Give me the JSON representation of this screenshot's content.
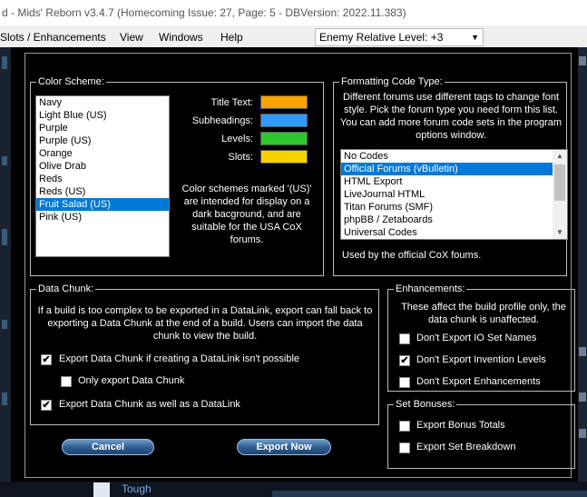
{
  "window": {
    "title": "d - Mids' Reborn v3.4.7  (Homecoming Issue: 27, Page: 5 - DBVersion: 2022.11.383)"
  },
  "menu": {
    "items": [
      "Slots / Enhancements",
      "View",
      "Windows",
      "Help"
    ],
    "enemy_level": "Enemy Relative Level: +3"
  },
  "background": {
    "power_label": "Tough"
  },
  "color_scheme": {
    "label": "Color Scheme:",
    "options": [
      "Navy",
      "Light Blue (US)",
      "Purple",
      "Purple (US)",
      "Orange",
      "Olive Drab",
      "Reds",
      "Reds (US)",
      "Fruit Salad (US)",
      "Pink (US)"
    ],
    "selected": "Fruit Salad (US)",
    "swatch_labels": {
      "title_text": "Title Text:",
      "subheadings": "Subheadings:",
      "levels": "Levels:",
      "slots": "Slots:"
    },
    "swatch_colors": {
      "title_text": "#f7a300",
      "subheadings": "#2f9bff",
      "levels": "#2ec72e",
      "slots": "#f5d200"
    },
    "note": "Color schemes marked '(US)' are intended for display on a dark bacground, and are suitable for the USA CoX forums."
  },
  "formatting": {
    "label": "Formatting Code Type:",
    "description": "Different forums use different tags to change font style. Pick the forum type you need form this list. You can add more forum code sets in the program options window.",
    "options": [
      "No Codes",
      "Official Forums (vBulletin)",
      "HTML Export",
      "LiveJournal HTML",
      "Titan Forums (SMF)",
      "phpBB / Zetaboards",
      "Universal Codes"
    ],
    "selected": "Official Forums (vBulletin)",
    "selection_info": "Used by the official CoX foums."
  },
  "data_chunk": {
    "label": "Data Chunk:",
    "description": "If a build is too complex to be exported in a DataLink, export can fall back to exporting a Data Chunk at the end of a build. Users can import the data chunk to view the build.",
    "opt_fallback": {
      "label": "Export Data Chunk if creating a DataLink isn't possible",
      "checked": true
    },
    "opt_only_chunk": {
      "label": "Only export Data Chunk",
      "checked": false
    },
    "opt_also_chunk": {
      "label": "Export Data Chunk as well as a DataLink",
      "checked": true
    }
  },
  "enhancements": {
    "label": "Enhancements:",
    "description": "These affect the build profile only, the data chunk is unaffected.",
    "opt_io_set_names": {
      "label": "Don't Export IO Set Names",
      "checked": false
    },
    "opt_invention_levels": {
      "label": "Don't Export Invention Levels",
      "checked": true
    },
    "opt_enhancements": {
      "label": "Don't Export Enhancements",
      "checked": false
    }
  },
  "set_bonuses": {
    "label": "Set Bonuses:",
    "opt_totals": {
      "label": "Export Bonus Totals",
      "checked": false
    },
    "opt_breakdown": {
      "label": "Export Set Breakdown",
      "checked": false
    }
  },
  "buttons": {
    "cancel": "Cancel",
    "export": "Export Now"
  },
  "icons": {
    "checked": "✔",
    "unchecked": ""
  }
}
